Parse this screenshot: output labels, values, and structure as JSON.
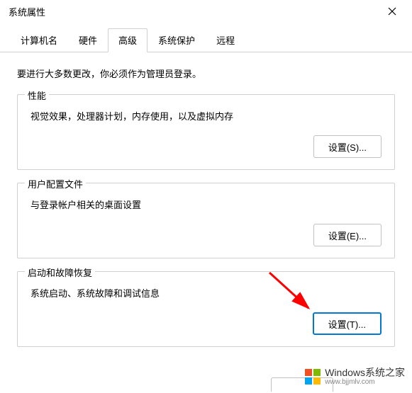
{
  "window": {
    "title": "系统属性"
  },
  "tabs": [
    {
      "label": "计算机名"
    },
    {
      "label": "硬件"
    },
    {
      "label": "高级"
    },
    {
      "label": "系统保护"
    },
    {
      "label": "远程"
    }
  ],
  "active_tab": 2,
  "instruction": "要进行大多数更改，你必须作为管理员登录。",
  "sections": {
    "performance": {
      "title": "性能",
      "desc": "视觉效果，处理器计划，内存使用，以及虚拟内存",
      "button": "设置(S)..."
    },
    "user_profiles": {
      "title": "用户配置文件",
      "desc": "与登录帐户相关的桌面设置",
      "button": "设置(E)..."
    },
    "startup_recovery": {
      "title": "启动和故障恢复",
      "desc": "系统启动、系统故障和调试信息",
      "button": "设置(T)..."
    }
  },
  "watermark": {
    "brand": "Windows",
    "suffix": "系统之家",
    "url": "www.bjjmlv.com"
  }
}
